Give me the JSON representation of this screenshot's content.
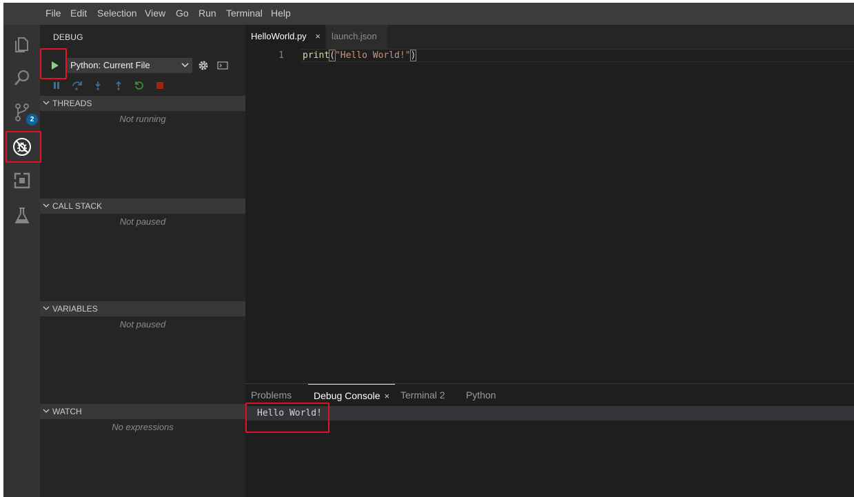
{
  "menubar": {
    "items": [
      "File",
      "Edit",
      "Selection",
      "View",
      "Go",
      "Run",
      "Terminal",
      "Help"
    ]
  },
  "activitybar": {
    "items": [
      {
        "icon": "files-icon"
      },
      {
        "icon": "search-icon"
      },
      {
        "icon": "source-control-icon",
        "badge": "2"
      },
      {
        "icon": "debug-icon",
        "active": true
      },
      {
        "icon": "extensions-icon"
      },
      {
        "icon": "testing-flask-icon"
      }
    ]
  },
  "sidebar": {
    "title": "DEBUG",
    "config_select": {
      "value": "Python: Current File"
    },
    "sections": [
      {
        "label": "THREADS",
        "message": "Not running"
      },
      {
        "label": "CALL STACK",
        "message": "Not paused"
      },
      {
        "label": "VARIABLES",
        "message": "Not paused"
      },
      {
        "label": "WATCH",
        "message": "No expressions"
      }
    ]
  },
  "editor": {
    "tabs": [
      {
        "label": "HelloWorld.py",
        "active": true,
        "close": "×"
      },
      {
        "label": "launch.json",
        "active": false
      }
    ],
    "line_number": "1",
    "code": {
      "fn": "print",
      "open": "(",
      "str": "\"Hello World!\"",
      "close": ")"
    }
  },
  "panel": {
    "tabs": [
      {
        "label": "Problems"
      },
      {
        "label": "Debug Console",
        "active": true,
        "close": "×"
      },
      {
        "label": "Terminal 2"
      },
      {
        "label": "Python"
      }
    ],
    "console_output": "Hello World!"
  },
  "colors": {
    "accent_highlight": "#e81123",
    "run_green": "#89d185",
    "stop_red": "#a1260d",
    "badge_blue": "#0e639c"
  }
}
